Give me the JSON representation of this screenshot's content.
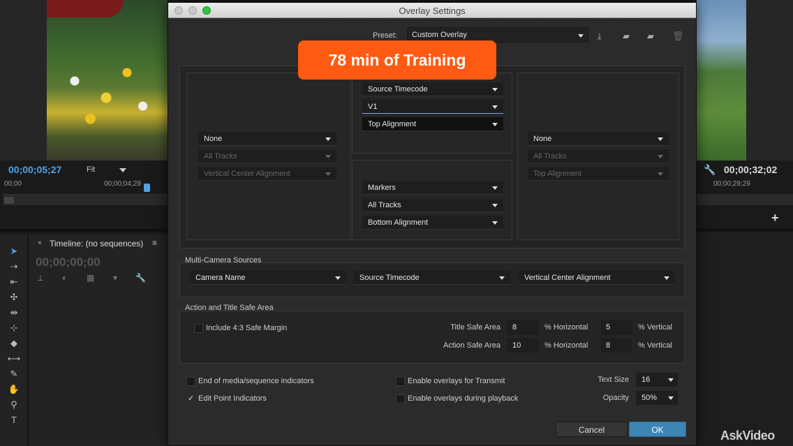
{
  "background": {
    "program_timecode_left": "00;00;05;27",
    "fit_label": "Fit",
    "ruler_left": [
      "00;00",
      "00;00;04;29"
    ],
    "program_timecode_right": "00;00;32;02",
    "ruler_right": "00;00;29;29",
    "timeline": {
      "title": "Timeline: (no sequences)",
      "close_glyph": "×",
      "menu_glyph": "≡",
      "timecode": "00;00;00;00"
    },
    "watermark": "AskVideo",
    "tools": [
      "selection-tool-icon",
      "track-select-tool-icon",
      "ripple-edit-tool-icon",
      "rolling-edit-tool-icon",
      "rate-stretch-tool-icon",
      "razor-tool-icon",
      "slip-tool-icon",
      "slide-tool-icon",
      "pen-tool-icon",
      "hand-tool-icon",
      "zoom-tool-icon"
    ]
  },
  "dialog": {
    "title": "Overlay Settings",
    "preset": {
      "label": "Preset:",
      "value": "Custom Overlay"
    },
    "preset_icons": [
      "save-preset-icon",
      "import-preset-icon",
      "export-preset-icon",
      "delete-preset-icon"
    ],
    "promo": "78 min of Training",
    "left_zone": {
      "type": "None",
      "tracks": "All Tracks",
      "alignment": "Vertical Center Alignment"
    },
    "top_center_zone": {
      "type": "Source Timecode",
      "tracks": "V1",
      "alignment": "Top Alignment"
    },
    "bottom_center_zone": {
      "type": "Markers",
      "tracks": "All Tracks",
      "alignment": "Bottom Alignment"
    },
    "right_zone": {
      "type": "None",
      "tracks": "All Tracks",
      "alignment": "Top Alignment"
    },
    "multicam": {
      "label": "Multi-Camera Sources",
      "name": "Camera Name",
      "type": "Source Timecode",
      "alignment": "Vertical Center Alignment"
    },
    "safe_area": {
      "label": "Action and Title Safe Area",
      "include_43": "Include 4:3 Safe Margin",
      "title_safe_label": "Title Safe Area",
      "title_h": "8",
      "title_v": "5",
      "action_safe_label": "Action Safe Area",
      "action_h": "10",
      "action_v": "8",
      "horizontal_label": "% Horizontal",
      "vertical_label": "% Vertical"
    },
    "options": {
      "end_indicators": "End of media/sequence indicators",
      "edit_point": "Edit Point Indicators",
      "edit_point_checkmark": "✓",
      "transmit": "Enable overlays for Transmit",
      "playback": "Enable overlays during playback",
      "text_size_label": "Text Size",
      "text_size": "16",
      "opacity_label": "Opacity",
      "opacity": "50%"
    },
    "buttons": {
      "cancel": "Cancel",
      "ok": "OK"
    }
  }
}
